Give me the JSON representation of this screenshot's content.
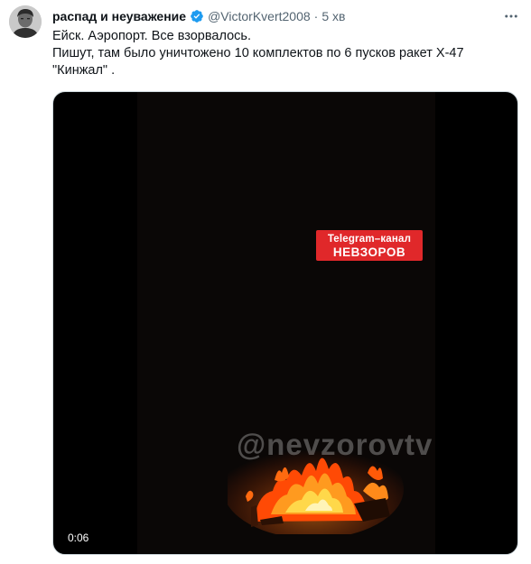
{
  "tweet": {
    "display_name": "распад и неуважение",
    "handle": "@VictorKvert2008",
    "separator": "·",
    "time": "5 хв",
    "text_lines": [
      "Ейск.  Аэропорт. Все взорвалось.",
      "Пишут, там было уничтожено 10 комплектов по 6 пусков ракет Х-47",
      "\"Кинжал\" ."
    ],
    "verified_icon": "verified-badge-icon",
    "more_icon": "more-horizontal-icon"
  },
  "video": {
    "overlay_line1": "Telegram–канал",
    "overlay_line2": "НЕВЗОРОВ",
    "watermark": "@nevzorovtv",
    "duration": "0:06"
  },
  "colors": {
    "verified": "#1d9bf0",
    "badge_red": "#e0282a",
    "secondary_text": "#536471"
  }
}
